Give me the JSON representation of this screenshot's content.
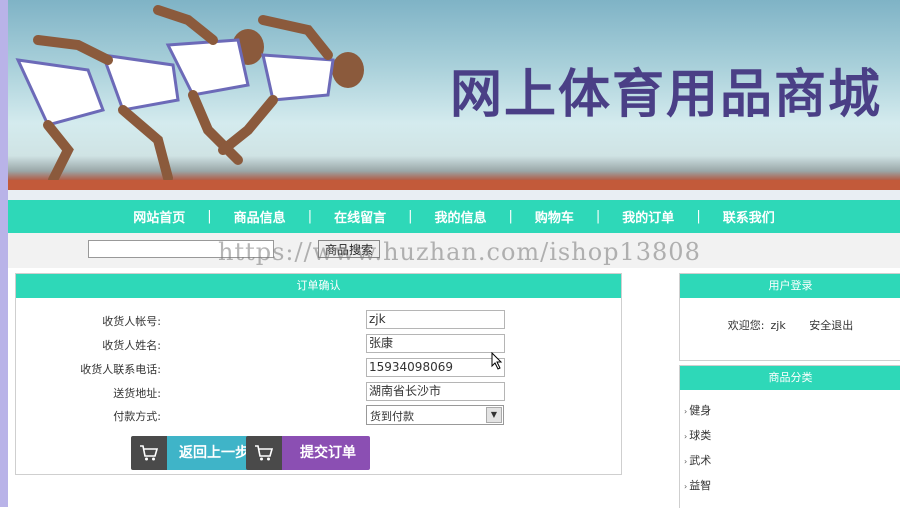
{
  "banner": {
    "title": "网上体育用品商城"
  },
  "nav": {
    "items": [
      "网站首页",
      "商品信息",
      "在线留言",
      "我的信息",
      "购物车",
      "我的订单",
      "联系我们"
    ]
  },
  "search": {
    "button_label": "商品搜索",
    "value": ""
  },
  "watermark": "https://www.huzhan.com/ishop13808",
  "order": {
    "title": "订单确认",
    "fields": [
      {
        "label": "收货人帐号:",
        "value": "zjk"
      },
      {
        "label": "收货人姓名:",
        "value": "张康"
      },
      {
        "label": "收货人联系电话:",
        "value": "15934098069"
      },
      {
        "label": "送货地址:",
        "value": "湖南省长沙市"
      }
    ],
    "payment_label": "付款方式:",
    "payment_value": "货到付款",
    "back_button": "返回上一步",
    "submit_button": "提交订单"
  },
  "login": {
    "title": "用户登录",
    "welcome": "欢迎您:",
    "username": "zjk",
    "logout": "安全退出"
  },
  "categories": {
    "title": "商品分类",
    "items": [
      "健身",
      "球类",
      "武术",
      "益智"
    ]
  },
  "icons": [
    "cart-icon",
    "chevron-down-icon",
    "bullet-icon",
    "mouse-pointer-icon"
  ],
  "colors": {
    "accent": "#2ed8b8",
    "title": "#4a3f86",
    "back_button": "#3fb4c8",
    "submit_button": "#8b4fb3"
  }
}
